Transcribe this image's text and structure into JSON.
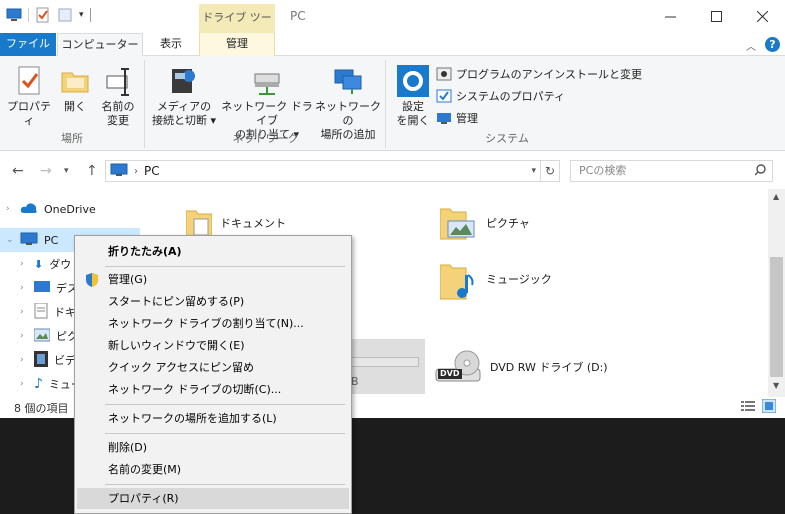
{
  "title": {
    "context_tab": "ドライブ ツール",
    "window": "PC"
  },
  "tabs": {
    "file": "ファイル",
    "computer": "コンピューター",
    "view": "表示",
    "manage": "管理"
  },
  "ribbon": {
    "groups": {
      "location": "場所",
      "network": "ネットワーク",
      "system": "システム"
    },
    "buttons": {
      "properties": "プロパティ",
      "open": "開く",
      "rename": "名前の\n変更",
      "media": "メディアの\n接続と切断 ▾",
      "map_drive": "ネットワーク ドライブ\nの割り当て ▾",
      "add_location": "ネットワークの\n場所の追加",
      "settings": "設定\nを開く",
      "uninstall": "プログラムのアンインストールと変更",
      "sys_props": "システムのプロパティ",
      "manage": "管理"
    }
  },
  "address": {
    "path": "PC",
    "search_placeholder": "PCの検索"
  },
  "nav": {
    "items": [
      "OneDrive",
      "PC",
      "ダウ",
      "デス",
      "ドキ",
      "ピク",
      "ビデ",
      "ミュー"
    ]
  },
  "content": {
    "documents": "ドキュメント",
    "pictures": "ピクチャ",
    "music": "ミュージック",
    "dvd": "DVD RW ドライブ (D:)",
    "dvd_badge": "DVD",
    "partial": "B"
  },
  "status": {
    "count": "8 個の項目"
  },
  "context_menu": {
    "items": [
      "折りたたみ(A)",
      "管理(G)",
      "スタートにピン留めする(P)",
      "ネットワーク ドライブの割り当て(N)...",
      "新しいウィンドウで開く(E)",
      "クイック アクセスにピン留め",
      "ネットワーク ドライブの切断(C)...",
      "ネットワークの場所を追加する(L)",
      "削除(D)",
      "名前の変更(M)",
      "プロパティ(R)"
    ]
  },
  "colors": {
    "accent": "#1979ca",
    "context_tab": "#f3eab7",
    "folder": "#f4d27a",
    "menu_bg": "#f2f2f2",
    "highlight": "#d9d9d9"
  }
}
